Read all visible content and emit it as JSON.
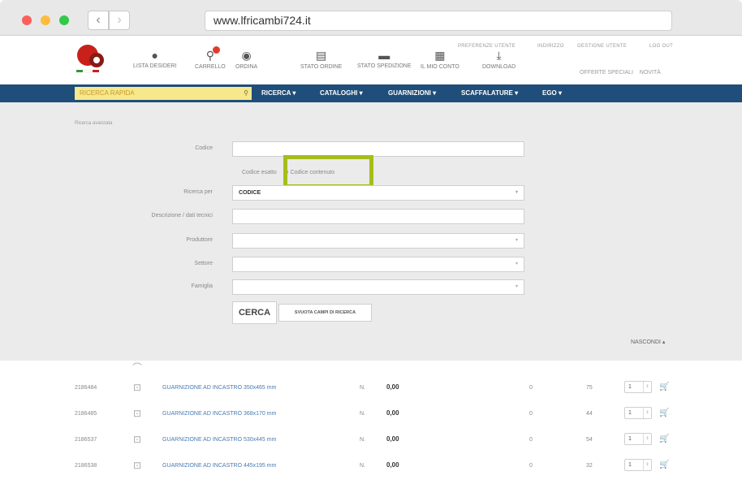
{
  "browser": {
    "url": "www.lfricambi724.it",
    "back_icon": "chevron-left-icon",
    "forward_icon": "chevron-right-icon"
  },
  "header": {
    "top_icons": [
      {
        "label": "LISTA DESIDERI",
        "icon": "circle-icon"
      },
      {
        "label": "CARRELLO",
        "icon": "cart-icon"
      },
      {
        "label": "ORDINA",
        "icon": "order-icon"
      },
      {
        "label": "STATO ORDINE",
        "icon": "clipboard-icon"
      },
      {
        "label": "STATO SPEDIZIONE",
        "icon": "truck-icon"
      },
      {
        "label": "IL MIO CONTO",
        "icon": "calendar-icon"
      },
      {
        "label": "DOWNLOAD",
        "icon": "download-icon"
      }
    ],
    "top_links": [
      "PREFERENZE UTENTE",
      "INDIRIZZO",
      "GESTIONE UTENTE",
      "LOG OUT"
    ],
    "right_links": [
      "OFFERTE SPECIALI",
      "NOVITÀ"
    ]
  },
  "nav": {
    "quick_search": "RICERCA RAPIDA",
    "items": [
      "RICERCA",
      "CATALOGHI",
      "GUARNIZIONI",
      "SCAFFALATURE",
      "EGO"
    ]
  },
  "form": {
    "breadcrumb": "Ricerca avanzata",
    "codice_label": "Codice",
    "codice_value": "",
    "radio_esatto": "Codice esatto",
    "radio_contenuto": "Codice contenuto",
    "ricerca_per_label": "Ricerca per",
    "ricerca_per_value": "CODICE",
    "descrizione_label": "Descrizione / dati tecnici",
    "descrizione_value": "",
    "produttore_label": "Produttore",
    "settore_label": "Settore",
    "famiglia_label": "Famiglia",
    "cerca_button": "CERCA",
    "svuota_button": "SVUOTA CAMPI DI RICERCA",
    "nascondi": "NASCONDI"
  },
  "results": {
    "rows": [
      {
        "code": "2186484",
        "description": "GUARNIZIONE AD INCASTRO 350x465 mm",
        "unit": "N.",
        "price": "0,00",
        "col_a": "0",
        "col_b": "75",
        "qty": "1"
      },
      {
        "code": "2186485",
        "description": "GUARNIZIONE AD INCASTRO 368x170 mm",
        "unit": "N.",
        "price": "0,00",
        "col_a": "0",
        "col_b": "44",
        "qty": "1"
      },
      {
        "code": "2186537",
        "description": "GUARNIZIONE AD INCASTRO 530x445 mm",
        "unit": "N.",
        "price": "0,00",
        "col_a": "0",
        "col_b": "54",
        "qty": "1"
      },
      {
        "code": "2186538",
        "description": "GUARNIZIONE AD INCASTRO 445x195 mm",
        "unit": "N.",
        "price": "0,00",
        "col_a": "0",
        "col_b": "32",
        "qty": "1"
      }
    ]
  },
  "colors": {
    "nav_blue": "#1f4e7a",
    "quick_search_bg": "#f6e88b",
    "highlight_green": "#a6bd1a",
    "link_blue": "#4a7ab3"
  }
}
